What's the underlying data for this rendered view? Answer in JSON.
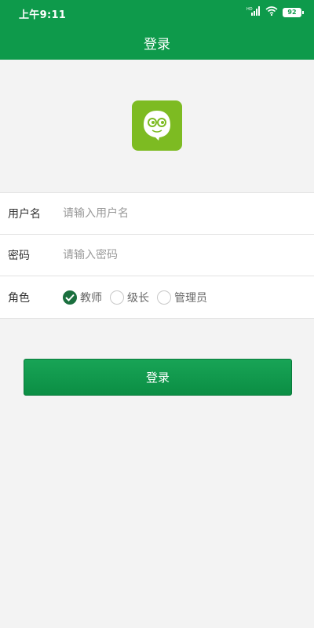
{
  "status_bar": {
    "time": "上午9:11",
    "network_label": "HD",
    "battery": "92"
  },
  "header": {
    "title": "登录"
  },
  "form": {
    "username": {
      "label": "用户名",
      "placeholder": "请输入用户名",
      "value": ""
    },
    "password": {
      "label": "密码",
      "placeholder": "请输入密码",
      "value": ""
    },
    "role": {
      "label": "角色",
      "options": [
        {
          "label": "教师",
          "checked": true
        },
        {
          "label": "级长",
          "checked": false
        },
        {
          "label": "管理员",
          "checked": false
        }
      ]
    }
  },
  "login_button": {
    "label": "登录"
  },
  "colors": {
    "primary": "#0e9a4b",
    "logo_bg": "#7dbb22",
    "radio_checked": "#1a6f3e"
  }
}
